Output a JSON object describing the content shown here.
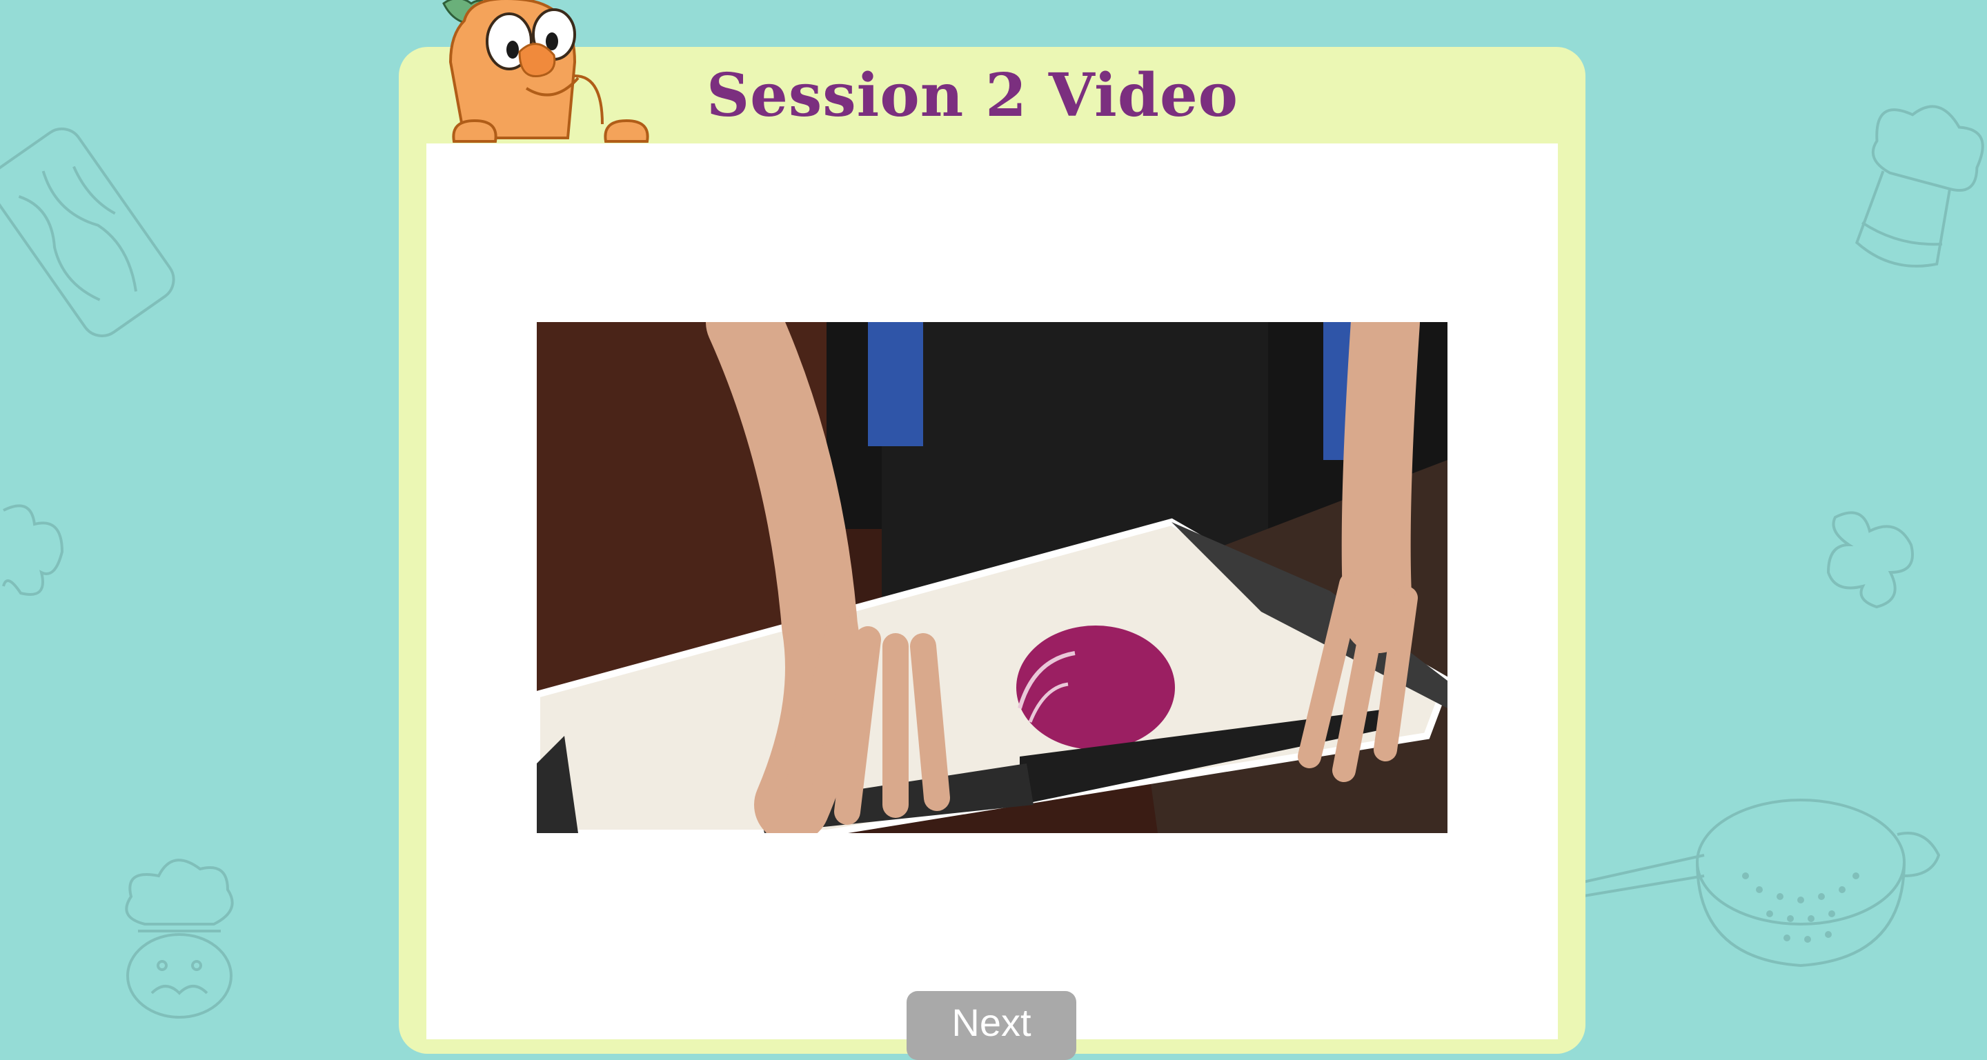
{
  "page": {
    "title": "Session 2 Video"
  },
  "video": {
    "subject": "hands with chef's knife and red onion on cutting board"
  },
  "actions": {
    "next_label": "Next"
  },
  "colors": {
    "background": "#95dcd6",
    "card": "#ebf7b4",
    "title": "#7b2f7f",
    "button": "#a9a9a9"
  },
  "icons": [
    "carrot-mascot-icon",
    "cutting-board-doodle-icon",
    "chef-hat-doodle-icon",
    "chef-doodle-icon",
    "colander-doodle-icon",
    "cookie-cutter-doodle-icon"
  ]
}
